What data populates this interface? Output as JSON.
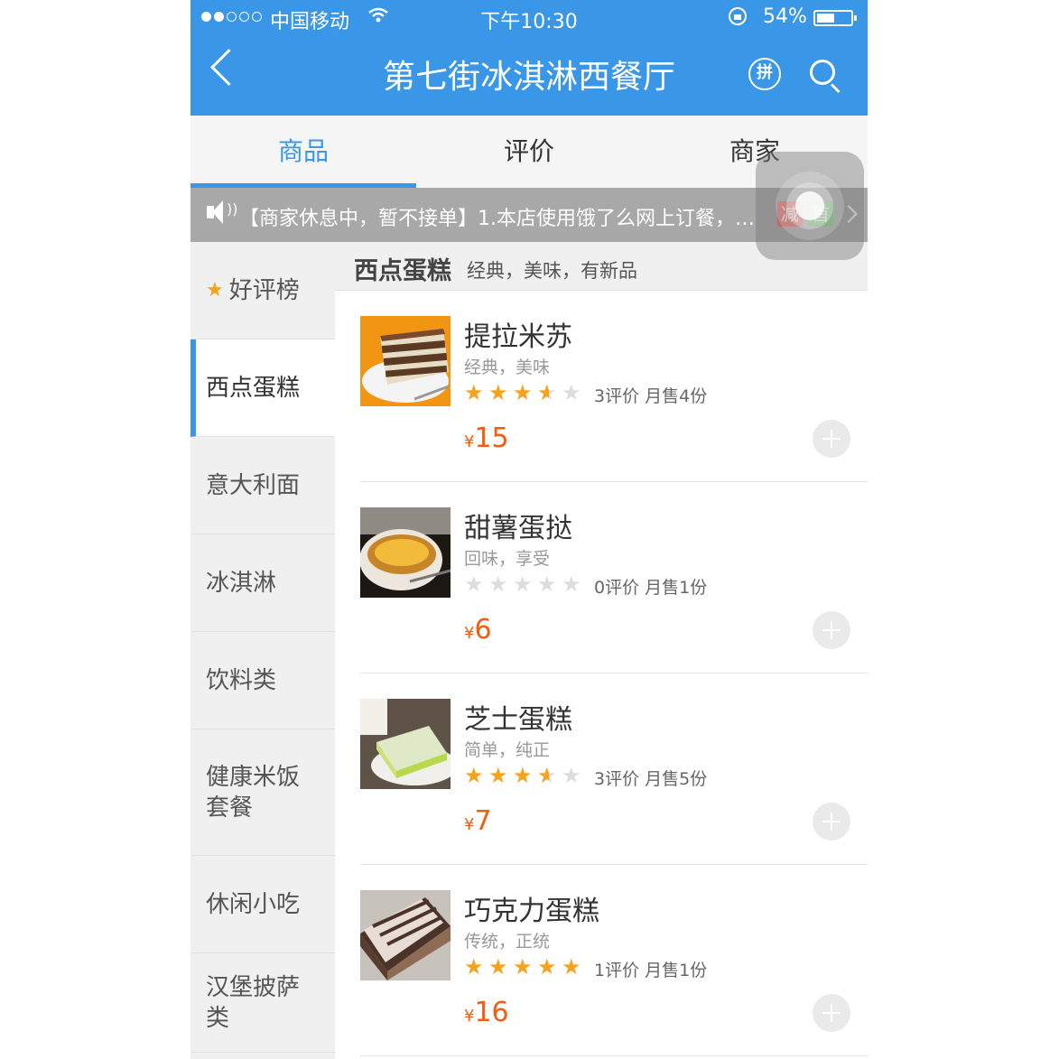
{
  "status": {
    "carrier": "中国移动",
    "time": "下午10:30",
    "battery_text": "54%",
    "battery_level": 0.54
  },
  "nav": {
    "title": "第七街冰淇淋西餐厅",
    "pin_label": "拼"
  },
  "tabs": [
    {
      "label": "商品"
    },
    {
      "label": "评价"
    },
    {
      "label": "商家"
    }
  ],
  "notice": {
    "text": "【商家休息中，暂不接单】1.本店使用饿了么网上订餐，优...",
    "badge1": "减",
    "badge2": "首"
  },
  "sidebar": [
    {
      "label": "好评榜"
    },
    {
      "label": "西点蛋糕"
    },
    {
      "label": "意大利面"
    },
    {
      "label": "冰淇淋"
    },
    {
      "label": "饮料类"
    },
    {
      "label": "健康米饭套餐"
    },
    {
      "label": "休闲小吃"
    },
    {
      "label": "汉堡披萨类"
    }
  ],
  "category": {
    "name": "西点蛋糕",
    "desc": "经典，美味，有新品"
  },
  "products": [
    {
      "name": "提拉米苏",
      "desc": "经典，美味",
      "rating": 3.5,
      "meta": "3评价  月售4份",
      "currency": "¥",
      "price": "15"
    },
    {
      "name": "甜薯蛋挞",
      "desc": "回味，享受",
      "rating": 0,
      "meta": "0评价  月售1份",
      "currency": "¥",
      "price": "6"
    },
    {
      "name": "芝士蛋糕",
      "desc": "简单，纯正",
      "rating": 3.5,
      "meta": "3评价  月售5份",
      "currency": "¥",
      "price": "7"
    },
    {
      "name": "巧克力蛋糕",
      "desc": "传统，正统",
      "rating": 5,
      "meta": "1评价  月售1份",
      "currency": "¥",
      "price": "16"
    }
  ],
  "colors": {
    "brand": "#3a96e6",
    "price": "#f65c0d",
    "star": "#f7a21b"
  },
  "icons": [
    "back-icon",
    "pin-icon",
    "search-icon",
    "speaker-icon",
    "chevron-right-icon",
    "plus-icon",
    "star-icon"
  ]
}
